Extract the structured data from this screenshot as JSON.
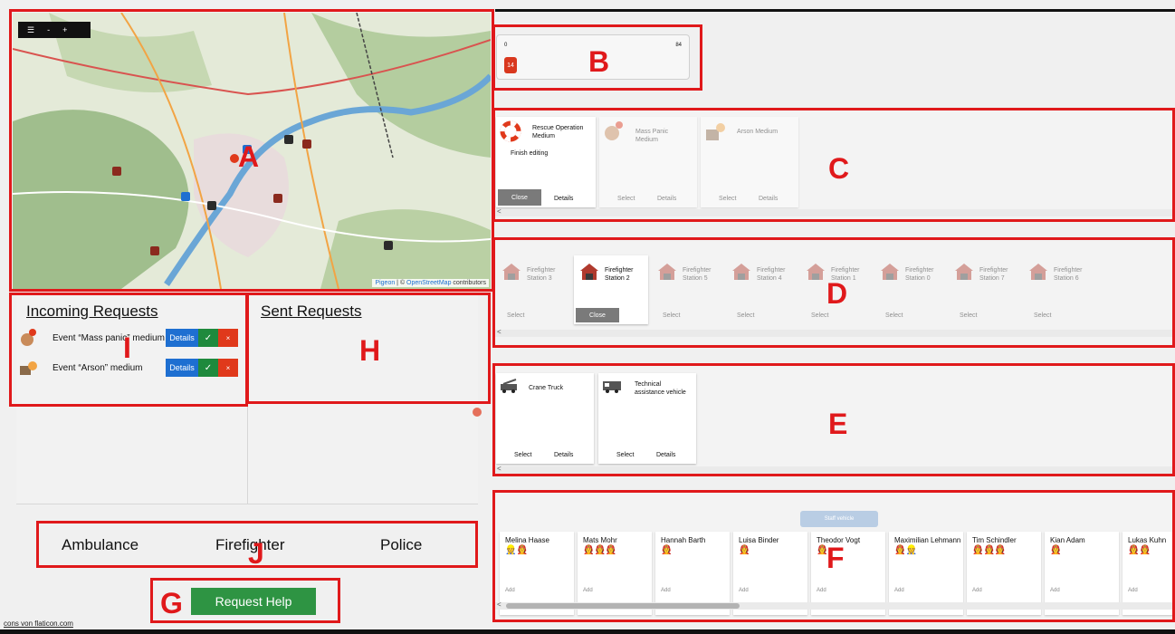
{
  "map": {
    "toolbar": [
      "☰",
      "-",
      "+"
    ],
    "attribution_link1": "Pigeon",
    "attribution_sep": " | © ",
    "attribution_link2": "OpenStreetMap",
    "attribution_tail": " contributors"
  },
  "requests": {
    "incoming_title": "Incoming Requests",
    "sent_title": "Sent Requests",
    "incoming": [
      {
        "text": "Event “Mass panic” medium",
        "details": "Details",
        "accept": "✓",
        "reject": "×"
      },
      {
        "text": "Event “Arson” medium",
        "details": "Details",
        "accept": "✓",
        "reject": "×"
      }
    ]
  },
  "categories": [
    "Ambulance",
    "Firefighter",
    "Police"
  ],
  "request_help_label": "Request Help",
  "credit": "cons von flaticon.com",
  "resource_summary": {
    "left_value": "0",
    "right_value": "84",
    "badge": "14"
  },
  "events": [
    {
      "title": "Rescue Operation Medium",
      "subtitle": "Finish editing",
      "primary": "Close",
      "secondary": "Details",
      "active": true
    },
    {
      "title": "Mass Panic Medium",
      "subtitle": "",
      "primary": "Select",
      "secondary": "Details",
      "active": false
    },
    {
      "title": "Arson Medium",
      "subtitle": "",
      "primary": "Select",
      "secondary": "Details",
      "active": false
    }
  ],
  "stations": [
    {
      "name": "Firefighter Station 3",
      "button": "Select",
      "active": false
    },
    {
      "name": "Firefighter Station 2",
      "button": "Close",
      "active": true
    },
    {
      "name": "Firefighter Station 5",
      "button": "Select",
      "active": false
    },
    {
      "name": "Firefighter Station 4",
      "button": "Select",
      "active": false
    },
    {
      "name": "Firefighter Station 1",
      "button": "Select",
      "active": false
    },
    {
      "name": "Firefighter Station 0",
      "button": "Select",
      "active": false
    },
    {
      "name": "Firefighter Station 7",
      "button": "Select",
      "active": false
    },
    {
      "name": "Firefighter Station 6",
      "button": "Select",
      "active": false
    }
  ],
  "vehicles": [
    {
      "name": "Crane Truck",
      "select": "Select",
      "details": "Details"
    },
    {
      "name": "Technical assistance vehicle",
      "select": "Select",
      "details": "Details"
    }
  ],
  "staff_vehicle_label": "Staff vehicle",
  "staff": [
    {
      "name": "Melina Haase",
      "icons": "👷👩‍🚒",
      "add": "Add"
    },
    {
      "name": "Mats Mohr",
      "icons": "👩‍🚒👩‍🚒👩‍🚒",
      "add": "Add"
    },
    {
      "name": "Hannah Barth",
      "icons": "👩‍🚒",
      "add": "Add"
    },
    {
      "name": "Luisa Binder",
      "icons": "👩‍🚒",
      "add": "Add"
    },
    {
      "name": "Theodor Vogt",
      "icons": "👩‍🚒",
      "add": "Add"
    },
    {
      "name": "Maximilian Lehmann",
      "icons": "👩‍🚒👷",
      "add": "Add"
    },
    {
      "name": "Tim Schindler",
      "icons": "👩‍🚒👩‍🚒👩‍🚒",
      "add": "Add"
    },
    {
      "name": "Kian Adam",
      "icons": "👩‍🚒",
      "add": "Add"
    },
    {
      "name": "Lukas Kuhn",
      "icons": "👩‍🚒👩‍🚒",
      "add": "Add"
    }
  ],
  "annotations": [
    "A",
    "B",
    "C",
    "D",
    "E",
    "F",
    "G",
    "H",
    "I",
    "J"
  ],
  "colors": {
    "annotation": "#e0191b",
    "details_blue": "#1e6fd1",
    "accept_green": "#1f8a3d",
    "reject_red": "#e0391b",
    "request_green": "#2e9443"
  }
}
